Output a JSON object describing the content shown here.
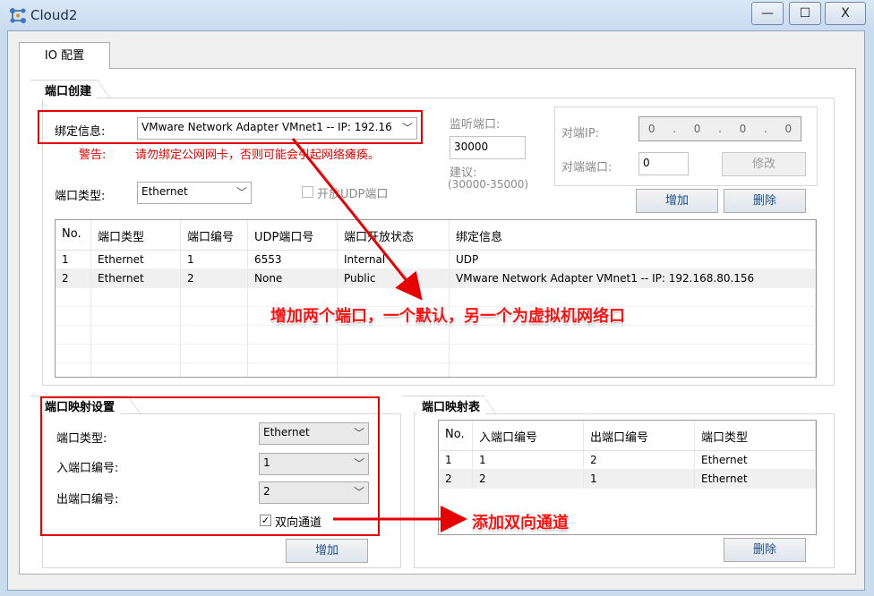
{
  "window": {
    "title": "Cloud2",
    "icons": {
      "app": "cloud-network-icon",
      "minimize": "minimize-icon",
      "maximize": "maximize-icon",
      "close": "close-icon"
    },
    "glyphs": {
      "minimize": "—",
      "maximize": "☐",
      "close": "X"
    }
  },
  "tabs": [
    {
      "label": "IO 配置",
      "active": true
    }
  ],
  "port_create": {
    "title": "端口创建",
    "binding_label": "绑定信息:",
    "binding_value": "VMware Network Adapter VMnet1 -- IP: 192.16",
    "warning_label": "警告:",
    "warning_text": "请勿绑定公网网卡，否则可能会引起网络瘫痪。",
    "port_type_label": "端口类型:",
    "port_type_value": "Ethernet",
    "open_udp_label": "开放UDP端口",
    "open_udp_checked": false,
    "listen_port_label": "监听端口:",
    "listen_port_value": "30000",
    "suggest_label": "建议:",
    "suggest_range": "(30000-35000)",
    "peer_ip_label": "对端IP:",
    "peer_ip_octets": [
      "0",
      "0",
      "0",
      "0"
    ],
    "peer_port_label": "对端端口:",
    "peer_port_value": "0",
    "modify_button": "修改",
    "add_button": "增加",
    "delete_button": "删除"
  },
  "port_table": {
    "columns": [
      "No.",
      "端口类型",
      "端口编号",
      "UDP端口号",
      "端口开放状态",
      "绑定信息"
    ],
    "rows": [
      [
        "1",
        "Ethernet",
        "1",
        "6553",
        "Internal",
        "UDP"
      ],
      [
        "2",
        "Ethernet",
        "2",
        "None",
        "Public",
        "VMware Network Adapter VMnet1 -- IP: 192.168.80.156"
      ]
    ]
  },
  "mapping_settings": {
    "title": "端口映射设置",
    "port_type_label": "端口类型:",
    "port_type_value": "Ethernet",
    "in_port_label": "入端口编号:",
    "in_port_value": "1",
    "out_port_label": "出端口编号:",
    "out_port_value": "2",
    "bidirectional_label": "双向通道",
    "bidirectional_checked": true,
    "add_button": "增加"
  },
  "mapping_table": {
    "title": "端口映射表",
    "columns": [
      "No.",
      "入端口编号",
      "出端口编号",
      "端口类型"
    ],
    "rows": [
      [
        "1",
        "1",
        "2",
        "Ethernet"
      ],
      [
        "2",
        "2",
        "1",
        "Ethernet"
      ]
    ],
    "delete_button": "删除"
  },
  "annotations": {
    "note_ports": "增加两个端口，一个默认，另一个为虚拟机网络口",
    "note_bidirectional": "添加双向通道",
    "color": "#e60000"
  }
}
